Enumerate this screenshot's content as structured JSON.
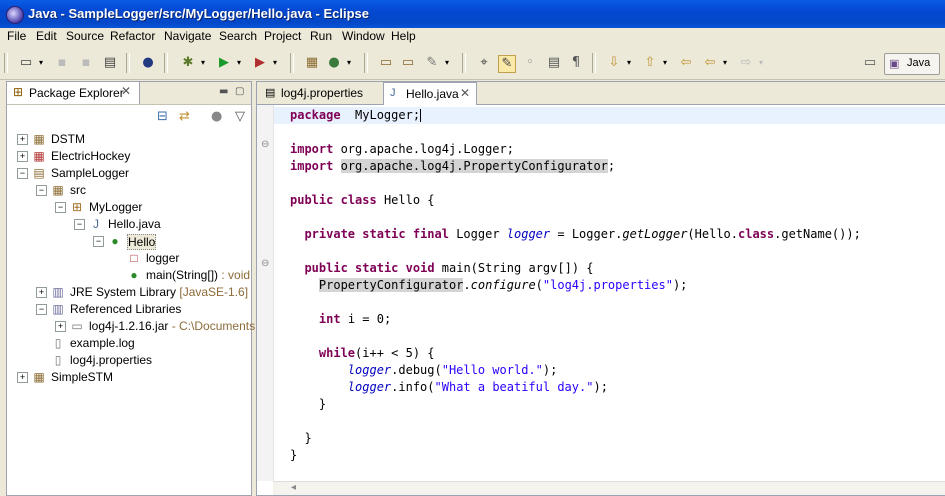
{
  "window": {
    "title": "Java - SampleLogger/src/MyLogger/Hello.java - Eclipse"
  },
  "menu": [
    "File",
    "Edit",
    "Source",
    "Refactor",
    "Navigate",
    "Search",
    "Project",
    "Run",
    "Window",
    "Help"
  ],
  "perspective": {
    "label": "Java"
  },
  "package_explorer": {
    "title": "Package Explorer",
    "tree": [
      {
        "label": "DSTM",
        "deco": "",
        "indent": 0,
        "exp": "+",
        "icon": "project-icon",
        "sym": "▦"
      },
      {
        "label": "ElectricHockey",
        "deco": "",
        "indent": 0,
        "exp": "+",
        "icon": "project-error-icon",
        "sym": "▦"
      },
      {
        "label": "SampleLogger",
        "deco": "",
        "indent": 0,
        "exp": "−",
        "icon": "project-open-icon",
        "sym": "▤"
      },
      {
        "label": "src",
        "deco": "",
        "indent": 1,
        "exp": "−",
        "icon": "source-folder-icon",
        "sym": "▦"
      },
      {
        "label": "MyLogger",
        "deco": "",
        "indent": 2,
        "exp": "−",
        "icon": "package-icon",
        "sym": "⊞"
      },
      {
        "label": "Hello.java",
        "deco": "",
        "indent": 3,
        "exp": "−",
        "icon": "java-file-icon",
        "sym": "J"
      },
      {
        "label": "Hello",
        "deco": "",
        "indent": 4,
        "exp": "−",
        "icon": "class-icon",
        "sym": "●"
      },
      {
        "label": "logger",
        "deco": "",
        "indent": 5,
        "exp": "",
        "icon": "field-icon",
        "sym": "□"
      },
      {
        "label": "main(String[])",
        "deco": " : void",
        "indent": 5,
        "exp": "",
        "icon": "method-icon",
        "sym": "●"
      },
      {
        "label": "JRE System Library",
        "deco": " [JavaSE-1.6]",
        "indent": 1,
        "exp": "+",
        "icon": "library-icon",
        "sym": "▥"
      },
      {
        "label": "Referenced Libraries",
        "deco": "",
        "indent": 1,
        "exp": "−",
        "icon": "library-icon",
        "sym": "▥"
      },
      {
        "label": "log4j-1.2.16.jar",
        "deco": " - C:\\Documents ...",
        "indent": 2,
        "exp": "+",
        "icon": "jar-icon",
        "sym": "▭"
      },
      {
        "label": "example.log",
        "deco": "",
        "indent": 1,
        "exp": "",
        "icon": "file-icon",
        "sym": "▯"
      },
      {
        "label": "log4j.properties",
        "deco": "",
        "indent": 1,
        "exp": "",
        "icon": "file-icon",
        "sym": "▯"
      },
      {
        "label": "SimpleSTM",
        "deco": "",
        "indent": 0,
        "exp": "+",
        "icon": "project-icon",
        "sym": "▦"
      }
    ]
  },
  "editor": {
    "tabs": [
      {
        "label": "log4j.properties",
        "active": false
      },
      {
        "label": "Hello.java",
        "active": true
      }
    ],
    "code": [
      [
        [
          "kw",
          "package"
        ],
        [
          "",
          "  MyLogger;"
        ]
      ],
      [],
      [
        [
          "kw",
          "import"
        ],
        [
          "",
          " org.apache.log4j.Logger;"
        ]
      ],
      [
        [
          "kw",
          "import"
        ],
        [
          "",
          " "
        ],
        [
          "hl",
          "org.apache.log4j.PropertyConfigurator"
        ],
        [
          "",
          ";"
        ]
      ],
      [],
      [
        [
          "kw",
          "public"
        ],
        [
          "",
          " "
        ],
        [
          "kw",
          "class"
        ],
        [
          "",
          " Hello {"
        ]
      ],
      [],
      [
        [
          "",
          "  "
        ],
        [
          "kw",
          "private"
        ],
        [
          "",
          " "
        ],
        [
          "kw",
          "static"
        ],
        [
          "",
          " "
        ],
        [
          "kw",
          "final"
        ],
        [
          "",
          " Logger "
        ],
        [
          "fld",
          "logger"
        ],
        [
          "",
          " = Logger."
        ],
        [
          "mth",
          "getLogger"
        ],
        [
          "",
          "(Hello."
        ],
        [
          "kw",
          "class"
        ],
        [
          "",
          ".getName());"
        ]
      ],
      [],
      [
        [
          "",
          "  "
        ],
        [
          "kw",
          "public"
        ],
        [
          "",
          " "
        ],
        [
          "kw",
          "static"
        ],
        [
          "",
          " "
        ],
        [
          "kw",
          "void"
        ],
        [
          "",
          " main(String argv[]) {"
        ]
      ],
      [
        [
          "",
          "    "
        ],
        [
          "hl",
          "PropertyConfigurator"
        ],
        [
          "",
          "."
        ],
        [
          "mth",
          "configure"
        ],
        [
          "",
          "("
        ],
        [
          "str",
          "\"log4j.properties\""
        ],
        [
          "",
          ");"
        ]
      ],
      [],
      [
        [
          "",
          "    "
        ],
        [
          "kw",
          "int"
        ],
        [
          "",
          " i = 0;"
        ]
      ],
      [],
      [
        [
          "",
          "    "
        ],
        [
          "kw",
          "while"
        ],
        [
          "",
          "(i++ < 5) {"
        ]
      ],
      [
        [
          "",
          "        "
        ],
        [
          "fld",
          "logger"
        ],
        [
          "",
          ".debug("
        ],
        [
          "str",
          "\"Hello world.\""
        ],
        [
          "",
          ");"
        ]
      ],
      [
        [
          "",
          "        "
        ],
        [
          "fld",
          "logger"
        ],
        [
          "",
          ".info("
        ],
        [
          "str",
          "\"What a beatiful day.\""
        ],
        [
          "",
          ");"
        ]
      ],
      [
        [
          "",
          "    }"
        ]
      ],
      [],
      [
        [
          "",
          "  }"
        ]
      ],
      [
        [
          "",
          "}"
        ]
      ]
    ]
  }
}
